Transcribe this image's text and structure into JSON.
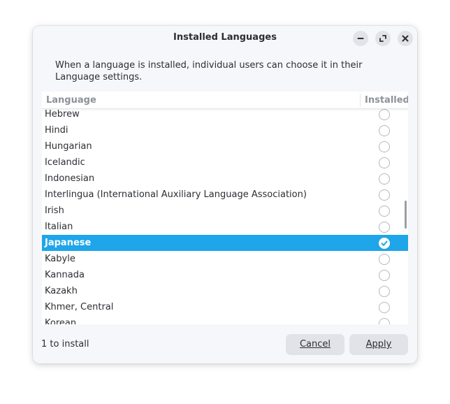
{
  "window": {
    "title": "Installed Languages"
  },
  "description": "When a language is installed, individual users can choose it in their Language settings.",
  "list": {
    "columns": {
      "language": "Language",
      "installed": "Installed"
    },
    "rows": [
      {
        "name": "Hebrew",
        "installed": false,
        "selected": false
      },
      {
        "name": "Hindi",
        "installed": false,
        "selected": false
      },
      {
        "name": "Hungarian",
        "installed": false,
        "selected": false
      },
      {
        "name": "Icelandic",
        "installed": false,
        "selected": false
      },
      {
        "name": "Indonesian",
        "installed": false,
        "selected": false
      },
      {
        "name": "Interlingua (International Auxiliary Language Association)",
        "installed": false,
        "selected": false
      },
      {
        "name": "Irish",
        "installed": false,
        "selected": false
      },
      {
        "name": "Italian",
        "installed": false,
        "selected": false
      },
      {
        "name": "Japanese",
        "installed": true,
        "selected": true
      },
      {
        "name": "Kabyle",
        "installed": false,
        "selected": false
      },
      {
        "name": "Kannada",
        "installed": false,
        "selected": false
      },
      {
        "name": "Kazakh",
        "installed": false,
        "selected": false
      },
      {
        "name": "Khmer, Central",
        "installed": false,
        "selected": false
      },
      {
        "name": "Korean",
        "installed": false,
        "selected": false
      }
    ]
  },
  "footer": {
    "status": "1 to install",
    "cancel_label": "Cancel",
    "apply_label": "Apply"
  },
  "colors": {
    "selection": "#1ea5ea",
    "dialog_bg": "#f6f7fa",
    "button_bg": "#e1e3e8"
  },
  "icons": {
    "minimize": "minimize-icon",
    "maximize": "maximize-icon",
    "close": "close-icon",
    "check": "checkmark-icon"
  }
}
